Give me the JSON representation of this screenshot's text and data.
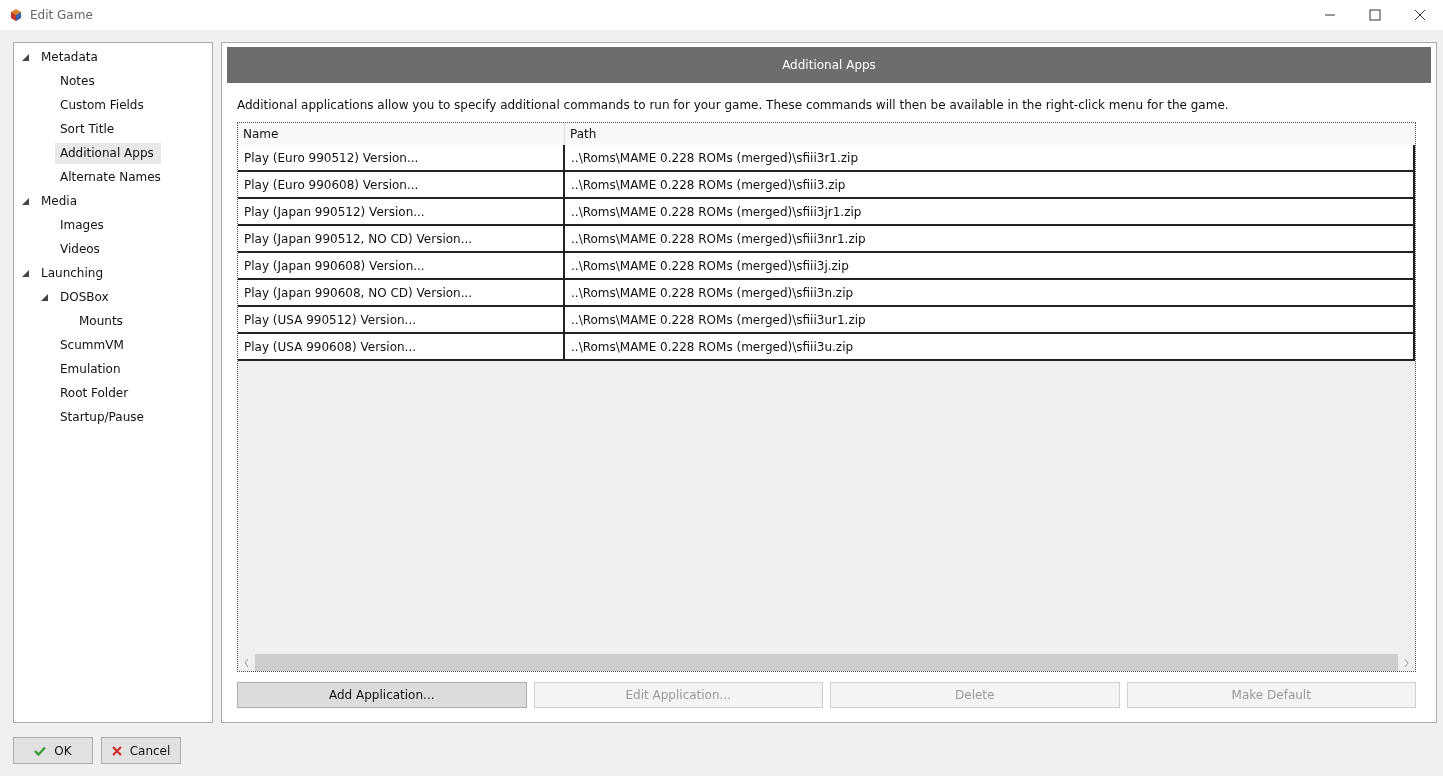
{
  "window": {
    "title": "Edit Game"
  },
  "sidebar": {
    "items": [
      {
        "label": "Metadata",
        "expanded": true,
        "selected": false,
        "children": [
          {
            "label": "Notes",
            "selected": false
          },
          {
            "label": "Custom Fields",
            "selected": false
          },
          {
            "label": "Sort Title",
            "selected": false
          },
          {
            "label": "Additional Apps",
            "selected": true
          },
          {
            "label": "Alternate Names",
            "selected": false
          }
        ]
      },
      {
        "label": "Media",
        "expanded": true,
        "selected": false,
        "children": [
          {
            "label": "Images",
            "selected": false
          },
          {
            "label": "Videos",
            "selected": false
          }
        ]
      },
      {
        "label": "Launching",
        "expanded": true,
        "selected": false,
        "children": [
          {
            "label": "DOSBox",
            "expanded": true,
            "selected": false,
            "children": [
              {
                "label": "Mounts",
                "selected": false
              }
            ]
          },
          {
            "label": "ScummVM",
            "selected": false
          },
          {
            "label": "Emulation",
            "selected": false
          },
          {
            "label": "Root Folder",
            "selected": false
          },
          {
            "label": "Startup/Pause",
            "selected": false
          }
        ]
      }
    ]
  },
  "panel": {
    "title": "Additional Apps",
    "description": "Additional applications allow you to specify additional commands to run for your game.  These commands will then be available in the right-click menu for the game."
  },
  "table": {
    "columns": [
      "Name",
      "Path"
    ],
    "rows": [
      [
        "Play (Euro 990512) Version...",
        "..\\Roms\\MAME 0.228 ROMs (merged)\\sfiii3r1.zip"
      ],
      [
        "Play (Euro 990608) Version...",
        "..\\Roms\\MAME 0.228 ROMs (merged)\\sfiii3.zip"
      ],
      [
        "Play (Japan 990512) Version...",
        "..\\Roms\\MAME 0.228 ROMs (merged)\\sfiii3jr1.zip"
      ],
      [
        "Play (Japan 990512, NO CD) Version...",
        "..\\Roms\\MAME 0.228 ROMs (merged)\\sfiii3nr1.zip"
      ],
      [
        "Play (Japan 990608) Version...",
        "..\\Roms\\MAME 0.228 ROMs (merged)\\sfiii3j.zip"
      ],
      [
        "Play (Japan 990608, NO CD) Version...",
        "..\\Roms\\MAME 0.228 ROMs (merged)\\sfiii3n.zip"
      ],
      [
        "Play (USA 990512) Version...",
        "..\\Roms\\MAME 0.228 ROMs (merged)\\sfiii3ur1.zip"
      ],
      [
        "Play (USA 990608) Version...",
        "..\\Roms\\MAME 0.228 ROMs (merged)\\sfiii3u.zip"
      ]
    ]
  },
  "actions": [
    {
      "label": "Add Application...",
      "disabled": false
    },
    {
      "label": "Edit Application...",
      "disabled": true
    },
    {
      "label": "Delete",
      "disabled": true
    },
    {
      "label": "Make Default",
      "disabled": true
    }
  ],
  "footer": [
    {
      "label": "OK",
      "kind": "ok"
    },
    {
      "label": "Cancel",
      "kind": "cancel"
    }
  ]
}
